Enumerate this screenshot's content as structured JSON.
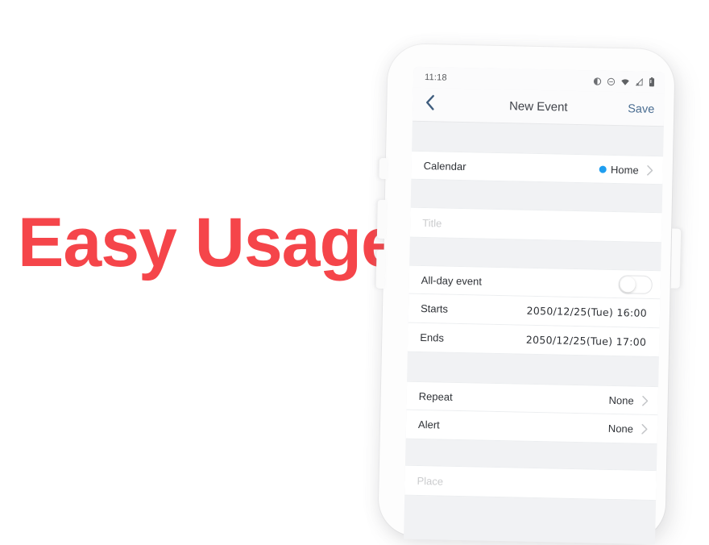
{
  "headline": {
    "text": "Easy Usage",
    "color": "#f5454a"
  },
  "phone": {
    "status_bar": {
      "time": "11:18",
      "icons": [
        "brightness-icon",
        "do-not-disturb-icon",
        "wifi-icon",
        "cellular-no-signal-icon",
        "battery-icon"
      ]
    },
    "nav_bar": {
      "back_icon": "chevron-left-icon",
      "title": "New Event",
      "save_label": "Save",
      "accent_color": "#4b6e92"
    },
    "form": {
      "calendar": {
        "label": "Calendar",
        "value": "Home",
        "dot_color": "#1f9ef0",
        "chevron": "chevron-right-icon"
      },
      "title_field": {
        "placeholder": "Title",
        "value": ""
      },
      "all_day": {
        "label": "All-day event",
        "toggle_state": "off"
      },
      "starts": {
        "label": "Starts",
        "value": "2050/12/25(Tue) 16:00"
      },
      "ends": {
        "label": "Ends",
        "value": "2050/12/25(Tue) 17:00"
      },
      "repeat": {
        "label": "Repeat",
        "value": "None",
        "chevron": "chevron-right-icon"
      },
      "alert": {
        "label": "Alert",
        "value": "None",
        "chevron": "chevron-right-icon"
      },
      "place_field": {
        "placeholder": "Place",
        "value": ""
      }
    }
  }
}
